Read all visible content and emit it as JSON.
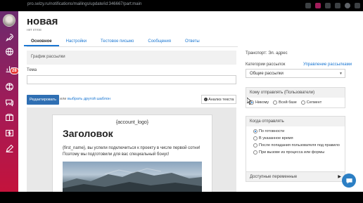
{
  "browser": {
    "url": "pro.selzy.ru/notifications/mailings/update/id:346667/part:main"
  },
  "sidebar": {
    "badge": "28",
    "items": [
      "rocket-icon",
      "globe-icon",
      "chart-icon",
      "globe-alt-icon",
      "chat-icon",
      "package-icon",
      "dollar-icon",
      "edit-icon"
    ]
  },
  "header": {
    "title": "новая",
    "subtitle": "нет ктгов"
  },
  "tabs": [
    {
      "label": "Основное",
      "active": true
    },
    {
      "label": "Настройки",
      "active": false
    },
    {
      "label": "Тестовое письмо",
      "active": false
    },
    {
      "label": "Сообщения",
      "active": false
    },
    {
      "label": "Ответы",
      "active": false
    }
  ],
  "schedule_section": {
    "label": "График рассылки"
  },
  "subject": {
    "label": "Тема",
    "value": ""
  },
  "editor_toolbar": {
    "edit_label": "Редактировать",
    "or_text": "или",
    "template_link": "выбрать другой шаблон",
    "analysis_label": "Анализ текста"
  },
  "email_preview": {
    "logo_placeholder": "{account_logo}",
    "heading": "Заголовок",
    "body": "{first_name}, вы успели подключиться к проекту в числе первой сотни! Поэтому мы подготовили для вас специальный бонус!"
  },
  "transport": {
    "label": "Транспорт: Эл. адрес"
  },
  "categories": {
    "label": "Категории рассылок",
    "manage_link": "Управление рассылками",
    "selected": "Общие рассылки"
  },
  "who_panel": {
    "title": "Кому отправлять (Пользователи)",
    "options": [
      {
        "label": "Никому",
        "checked": true
      },
      {
        "label": "Всей базе",
        "checked": false
      },
      {
        "label": "Сегмент",
        "checked": false
      }
    ]
  },
  "when_panel": {
    "title": "Когда отправлять",
    "options": [
      {
        "label": "По готовности",
        "checked": true
      },
      {
        "label": "В указанное время",
        "checked": false
      },
      {
        "label": "После попадания пользователя под правило",
        "checked": false
      },
      {
        "label": "При вызове из процесса или формы",
        "checked": false
      }
    ]
  },
  "variables": {
    "label": "Доступные переменные"
  },
  "colors": {
    "accent": "#2f6fb3",
    "sidebar_top": "#6b2a6e",
    "sidebar_bottom": "#c4133c",
    "link": "#1976d2"
  }
}
